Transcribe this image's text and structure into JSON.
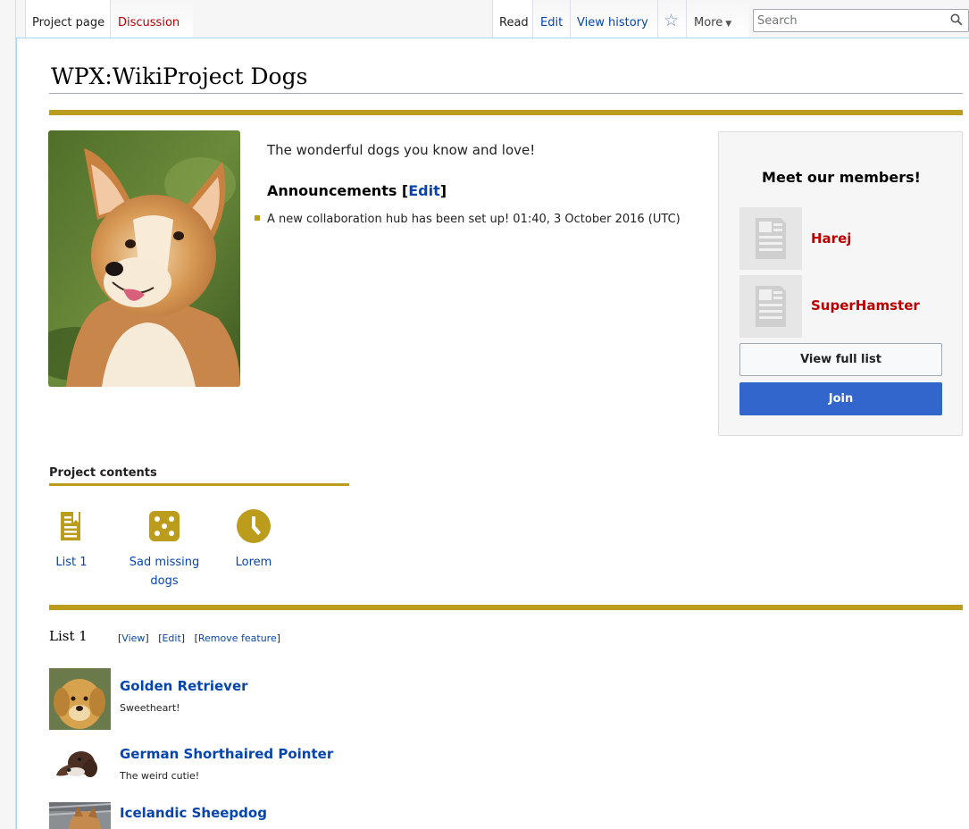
{
  "tabs": {
    "project_page": "Project page",
    "discussion": "Discussion",
    "read": "Read",
    "edit": "Edit",
    "view_history": "View history",
    "more": "More"
  },
  "search": {
    "placeholder": "Search"
  },
  "page": {
    "title": "WPX:WikiProject Dogs"
  },
  "intro": {
    "tagline": "The wonderful dogs you know and love!",
    "announcements_heading": "Announcements [",
    "announcements_edit": "Edit",
    "announcements_close": "]",
    "announcement_text": "A new collaboration hub has been set up! 01:40, 3 October 2016 (UTC)"
  },
  "members": {
    "title": "Meet our members!",
    "list": [
      {
        "name": "Harej"
      },
      {
        "name": "SuperHamster"
      }
    ],
    "view_full_list": "View full list",
    "join": "Join"
  },
  "project_contents": {
    "title": "Project contents",
    "items": [
      {
        "label": "List 1",
        "icon": "bookmark-document-icon"
      },
      {
        "label": "Sad missing dogs",
        "icon": "dice-icon"
      },
      {
        "label": "Lorem",
        "icon": "clock-icon"
      }
    ]
  },
  "list1": {
    "title": "List 1",
    "view": "View",
    "edit": "Edit",
    "remove_feature": "Remove feature",
    "entries": [
      {
        "name": "Golden Retriever",
        "desc": "Sweetheart!"
      },
      {
        "name": "German Shorthaired Pointer",
        "desc": "The weird cutie!"
      },
      {
        "name": "Icelandic Sheepdog",
        "desc": ""
      }
    ]
  },
  "colors": {
    "accent_gold": "#bc9c1c",
    "link_blue": "#0645ad",
    "redlink": "#ba0000",
    "join_blue": "#3366cc"
  }
}
